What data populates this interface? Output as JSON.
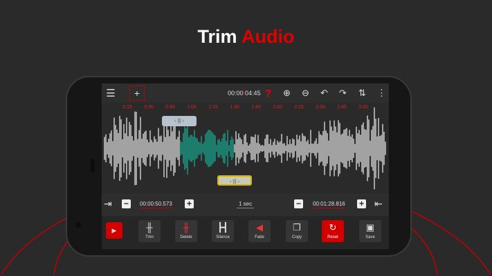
{
  "headline": {
    "word1": "Trim",
    "word2": "Audio"
  },
  "colors": {
    "accent": "#e00000",
    "selection": "#17b39a",
    "background": "#2a2a2a"
  },
  "toolbar": {
    "current_time": "00:00",
    "total_time": "04:45",
    "icons": [
      "menu-icon",
      "add-icon",
      "help-icon",
      "zoom-in-icon",
      "zoom-out-icon",
      "undo-icon",
      "redo-icon",
      "sort-icon",
      "more-icon"
    ]
  },
  "timeline": [
    "0:15",
    "0:30",
    "0:45",
    "1:00",
    "1:15",
    "1:30",
    "1:45",
    "2:00",
    "2:15",
    "2:30",
    "2:45",
    "3:00"
  ],
  "selection": {
    "start": "00:00:50.573",
    "end": "00:01:28.816",
    "step": "1 sec"
  },
  "tools": [
    {
      "label": "",
      "icon": "play-icon"
    },
    {
      "label": "Trim",
      "icon": "trim-icon"
    },
    {
      "label": "Delete",
      "icon": "delete-icon"
    },
    {
      "label": "Silence",
      "icon": "silence-icon"
    },
    {
      "label": "Fade",
      "icon": "fade-icon"
    },
    {
      "label": "Copy",
      "icon": "copy-icon"
    },
    {
      "label": "Reset",
      "icon": "reset-icon"
    },
    {
      "label": "Save",
      "icon": "save-icon"
    }
  ]
}
